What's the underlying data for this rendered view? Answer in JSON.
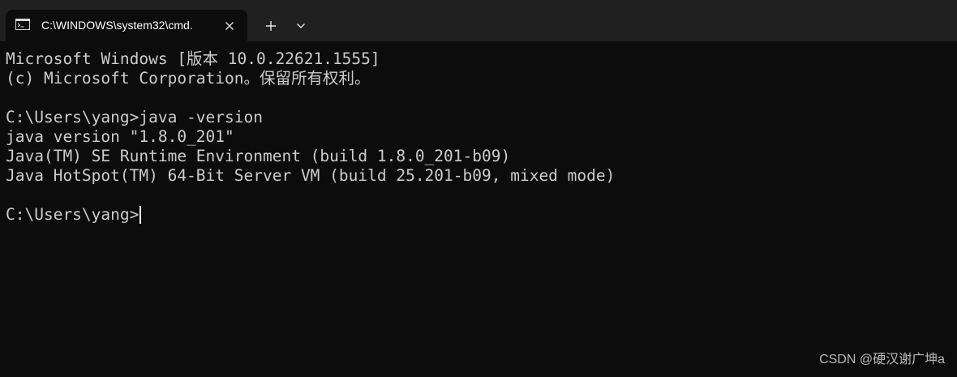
{
  "tab": {
    "title": "C:\\WINDOWS\\system32\\cmd.",
    "icon": "cmd-icon",
    "close_icon": "close-icon"
  },
  "toolbar": {
    "new_tab_icon": "plus-icon",
    "dropdown_icon": "chevron-down-icon"
  },
  "terminal": {
    "lines": [
      "Microsoft Windows [版本 10.0.22621.1555]",
      "(c) Microsoft Corporation。保留所有权利。",
      "",
      "C:\\Users\\yang>java -version",
      "java version \"1.8.0_201\"",
      "Java(TM) SE Runtime Environment (build 1.8.0_201-b09)",
      "Java HotSpot(TM) 64-Bit Server VM (build 25.201-b09, mixed mode)",
      ""
    ],
    "prompt": "C:\\Users\\yang>"
  },
  "watermark": "CSDN @硬汉谢广坤a",
  "colors": {
    "background": "#0c0c0c",
    "tab_strip": "#202020",
    "text": "#cccccc",
    "cursor": "#ffffff"
  }
}
